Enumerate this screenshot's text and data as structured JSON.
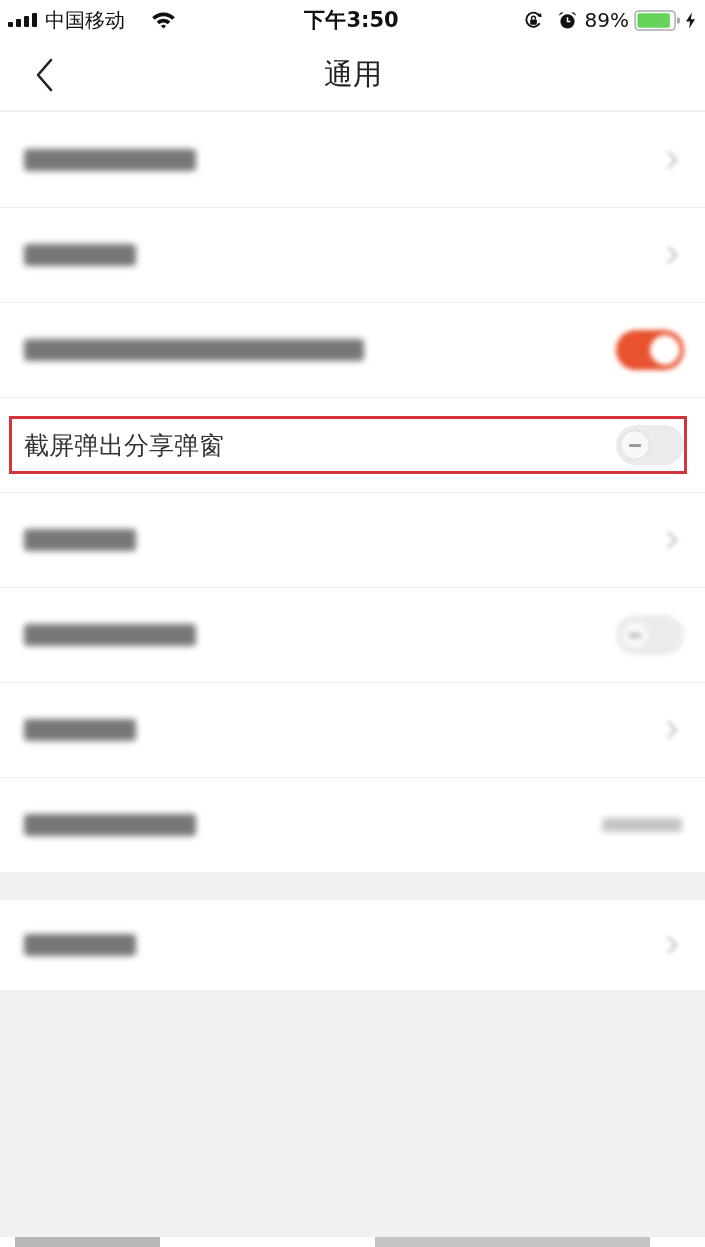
{
  "status_bar": {
    "carrier": "中国移动",
    "time": "下午3:50",
    "battery_percent": "89%",
    "charging": true
  },
  "nav_bar": {
    "title": "通用"
  },
  "groups": [
    {
      "rows": [
        {
          "kind": "blurred",
          "trailing": {
            "kind": "chevron"
          },
          "highlighted": false
        },
        {
          "kind": "blurred",
          "trailing": {
            "kind": "chevron"
          },
          "highlighted": false
        },
        {
          "kind": "blurred",
          "trailing": {
            "kind": "switch",
            "on": true
          },
          "highlighted": false
        },
        {
          "kind": "setting",
          "label": "截屏弹出分享弹窗",
          "trailing": {
            "kind": "switch",
            "on": false
          },
          "highlighted": true
        },
        {
          "kind": "blurred",
          "trailing": {
            "kind": "chevron"
          },
          "highlighted": false
        },
        {
          "kind": "blurred",
          "trailing": {
            "kind": "switch",
            "on": false
          },
          "highlighted": false
        },
        {
          "kind": "blurred",
          "trailing": {
            "kind": "chevron"
          },
          "highlighted": false
        },
        {
          "kind": "blurred",
          "trailing": {
            "kind": "value"
          },
          "highlighted": false
        }
      ]
    },
    {
      "rows": [
        {
          "kind": "blurred",
          "trailing": {
            "kind": "chevron"
          },
          "highlighted": false
        }
      ]
    }
  ]
}
